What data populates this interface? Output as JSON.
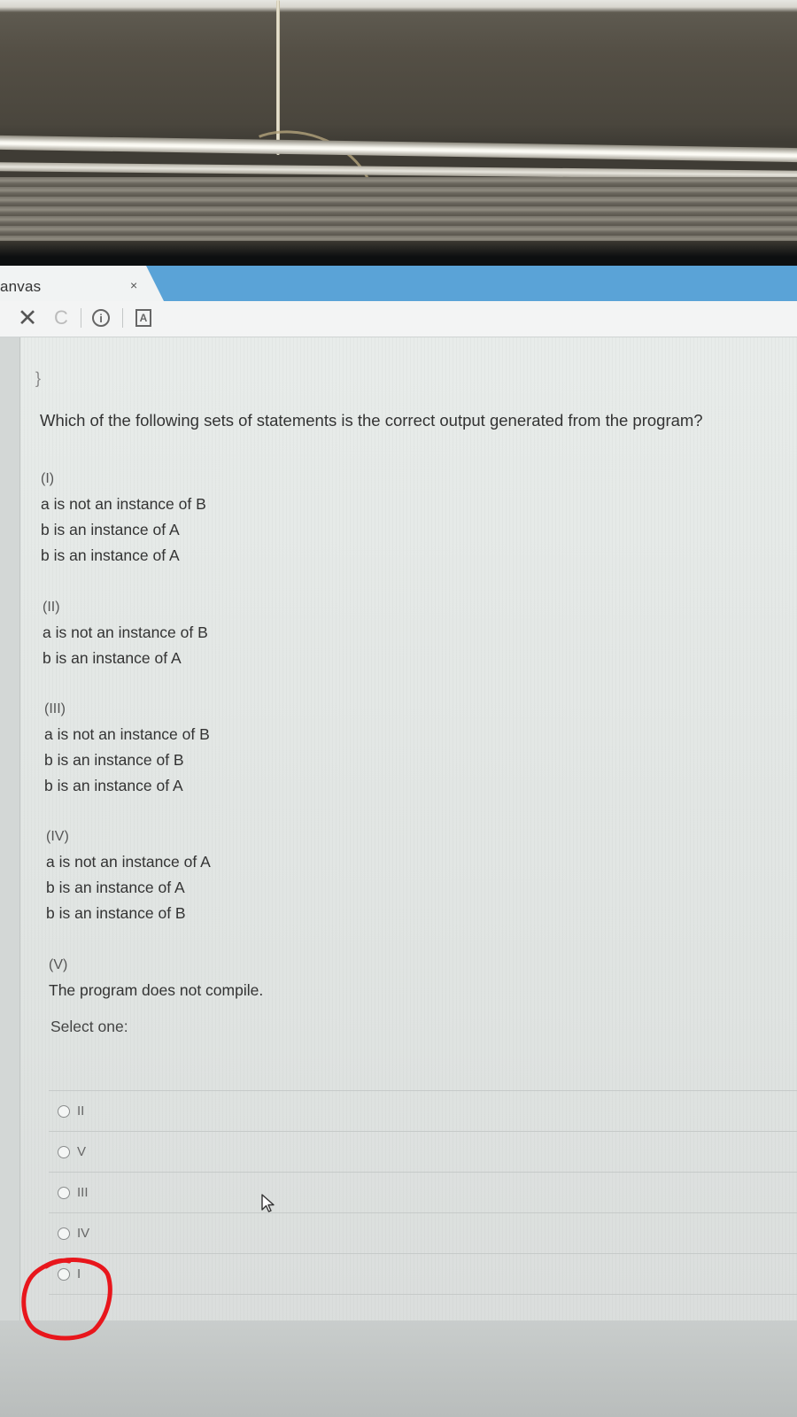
{
  "browser": {
    "tab_title": "anvas",
    "tab_close": "×",
    "stop_glyph": "✕",
    "reload_glyph": "C",
    "info_glyph": "i",
    "reader_glyph": "A"
  },
  "question": {
    "code_tail": "}",
    "prompt": "Which of the following sets of statements is the correct output generated from the program?",
    "options": [
      {
        "label": "(I)",
        "lines": [
          "a is not an instance of B",
          "b is an instance of A",
          "b is an instance of A"
        ]
      },
      {
        "label": "(II)",
        "lines": [
          "a is not an instance of B",
          "b is an instance of A"
        ]
      },
      {
        "label": "(III)",
        "lines": [
          "a is not an instance of B",
          "b is an instance of B",
          "b is an instance of A"
        ]
      },
      {
        "label": "(IV)",
        "lines": [
          "a is not an instance of A",
          "b is an instance of A",
          "b is an instance of B"
        ]
      },
      {
        "label": "(V)",
        "lines": [
          "The program does not compile."
        ]
      }
    ],
    "select_prompt": "Select one:",
    "answers": [
      "II",
      "V",
      "III",
      "IV",
      "I"
    ],
    "highlighted_answer": "I"
  },
  "colors": {
    "tabbar": "#5aa3d7",
    "annotation": "#e8161c"
  }
}
